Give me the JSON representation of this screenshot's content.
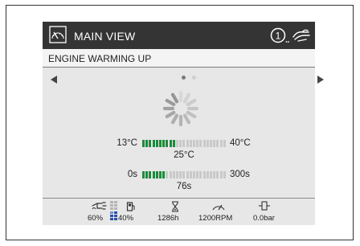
{
  "header": {
    "title": "MAIN VIEW",
    "alert_icon": "alert-number-icon",
    "alert_number": "1",
    "view_icon": "gauge-view-icon",
    "hand_icon": "hand-icon"
  },
  "status": {
    "text": "ENGINE WARMING UP"
  },
  "pager": {
    "page_count": 2,
    "active_page": 1
  },
  "gauges": {
    "temperature": {
      "min_label": "13°C",
      "max_label": "40°C",
      "value_label": "25°C",
      "segments_total": 25,
      "segments_filled": 10
    },
    "time": {
      "min_label": "0s",
      "max_label": "300s",
      "value_label": "76s",
      "segments_total": 25,
      "segments_filled": 7
    }
  },
  "footer": {
    "def_level": "60%",
    "fuel_level": "40%",
    "hours": "1286h",
    "rpm": "1200RPM",
    "pressure": "0.0bar"
  },
  "colors": {
    "header_bg": "#343434",
    "screen_bg": "#e7e7e7",
    "gauge_fill": "#1e8a3c",
    "gauge_empty": "#c9c9c9",
    "fuel_fill": "#2f4fa0"
  }
}
